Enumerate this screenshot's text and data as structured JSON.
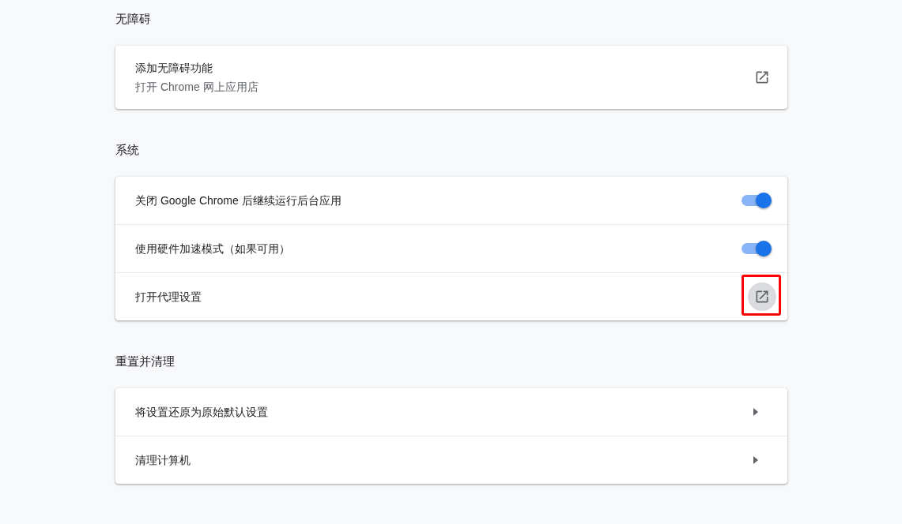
{
  "sections": [
    {
      "title": "无障碍",
      "rows": [
        {
          "kind": "external",
          "label": "添加无障碍功能",
          "sublabel": "打开 Chrome 网上应用店",
          "highlighted": false
        }
      ]
    },
    {
      "title": "系统",
      "rows": [
        {
          "kind": "toggle",
          "label": "关闭 Google Chrome 后继续运行后台应用",
          "on": true
        },
        {
          "kind": "toggle",
          "label": "使用硬件加速模式（如果可用）",
          "on": true
        },
        {
          "kind": "external",
          "label": "打开代理设置",
          "highlighted": true
        }
      ]
    },
    {
      "title": "重置并清理",
      "rows": [
        {
          "kind": "arrow",
          "label": "将设置还原为原始默认设置"
        },
        {
          "kind": "arrow",
          "label": "清理计算机"
        }
      ]
    }
  ]
}
